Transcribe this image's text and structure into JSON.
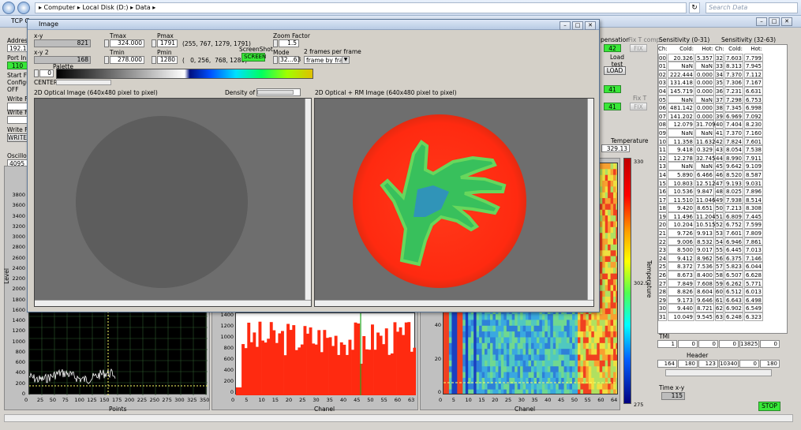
{
  "explorer": {
    "path": "▸ Computer ▸ Local Disk (D:) ▸ Data ▸",
    "search_placeholder": "Search Data"
  },
  "bgapp": {
    "title": "TCP G",
    "address_label": "Address",
    "address_value": "192.16",
    "port_label": "Port Inp",
    "port_value": "110",
    "start_label": "Start Fr",
    "config_label": "Configu",
    "off_label": "OFF",
    "write1_label": "Write Fi",
    "write2_label": "Write Fi",
    "write3_label": "Write Fi",
    "write_btn": "WRITE",
    "osc_label": "Oscillosc",
    "osc_top": "4095",
    "compensation_label": "pensation",
    "comp_val": "42",
    "load_test_label": "Load test T",
    "load_btn": "LOAD",
    "val41a": "41",
    "val41b": "41",
    "fix_t_comp_label": "Fix T comp",
    "fix_btn1": "FIX",
    "fix_t_label": "Fix T",
    "fix_btn2": "FIX",
    "temp_label": "Temperature",
    "temp_value": "329.13",
    "temp_axis_label": "Temperature",
    "colorbar_ticks": [
      "330",
      "302.5",
      "275"
    ],
    "sens_label1": "Sensitivity (0-31)",
    "sens_label2": "Sensitivity (32-63)",
    "sens_head": [
      "Ch:",
      "Cold:",
      "Hot:",
      "Ch:",
      "Cold:",
      "Hot:"
    ],
    "sens_rows": [
      [
        "00",
        "20.326",
        "5.357",
        "32",
        "7.603",
        "7.799"
      ],
      [
        "01",
        "NaN",
        "NaN",
        "33",
        "8.313",
        "7.945"
      ],
      [
        "02",
        "222.444",
        "0.000",
        "34",
        "7.370",
        "7.112"
      ],
      [
        "03",
        "131.418",
        "0.000",
        "35",
        "7.306",
        "7.167"
      ],
      [
        "04",
        "145.719",
        "0.000",
        "36",
        "7.231",
        "6.631"
      ],
      [
        "05",
        "NaN",
        "NaN",
        "37",
        "7.298",
        "6.753"
      ],
      [
        "06",
        "481.142",
        "0.000",
        "38",
        "7.345",
        "6.998"
      ],
      [
        "07",
        "141.202",
        "0.000",
        "39",
        "6.969",
        "7.092"
      ],
      [
        "08",
        "12.079",
        "31.709",
        "40",
        "7.404",
        "8.230"
      ],
      [
        "09",
        "NaN",
        "NaN",
        "41",
        "7.370",
        "7.160"
      ],
      [
        "10",
        "11.358",
        "11.632",
        "42",
        "7.824",
        "7.601"
      ],
      [
        "11",
        "9.418",
        "0.329",
        "43",
        "8.054",
        "7.538"
      ],
      [
        "12",
        "12.278",
        "32.745",
        "44",
        "8.990",
        "7.911"
      ],
      [
        "13",
        "NaN",
        "NaN",
        "45",
        "9.642",
        "9.109"
      ],
      [
        "14",
        "5.890",
        "6.466",
        "46",
        "8.520",
        "8.587"
      ],
      [
        "15",
        "10.803",
        "12.512",
        "47",
        "9.193",
        "9.031"
      ],
      [
        "16",
        "10.536",
        "9.847",
        "48",
        "8.025",
        "7.896"
      ],
      [
        "17",
        "11.510",
        "11.046",
        "49",
        "7.938",
        "8.514"
      ],
      [
        "18",
        "9.420",
        "8.651",
        "50",
        "7.213",
        "8.308"
      ],
      [
        "19",
        "11.496",
        "11.204",
        "51",
        "6.809",
        "7.445"
      ],
      [
        "20",
        "10.204",
        "10.515",
        "52",
        "6.752",
        "7.599"
      ],
      [
        "21",
        "9.726",
        "9.913",
        "53",
        "7.601",
        "7.809"
      ],
      [
        "22",
        "9.006",
        "8.532",
        "54",
        "6.946",
        "7.861"
      ],
      [
        "23",
        "8.500",
        "9.017",
        "55",
        "6.445",
        "7.013"
      ],
      [
        "24",
        "9.412",
        "8.962",
        "56",
        "6.375",
        "7.146"
      ],
      [
        "25",
        "8.372",
        "7.536",
        "57",
        "5.823",
        "6.044"
      ],
      [
        "26",
        "8.673",
        "8.400",
        "58",
        "6.507",
        "6.628"
      ],
      [
        "27",
        "7.849",
        "7.608",
        "59",
        "6.262",
        "5.771"
      ],
      [
        "28",
        "8.826",
        "8.604",
        "60",
        "6.512",
        "6.013"
      ],
      [
        "29",
        "9.173",
        "9.646",
        "61",
        "6.643",
        "6.498"
      ],
      [
        "30",
        "9.440",
        "8.721",
        "62",
        "6.902",
        "6.549"
      ],
      [
        "31",
        "10.049",
        "9.545",
        "63",
        "6.248",
        "6.323"
      ]
    ],
    "tmi_label": "TMI",
    "tmi_values": [
      "1",
      "0",
      "0",
      "0",
      "13825",
      "0"
    ],
    "header_label": "Header",
    "header_values": [
      "164",
      "180",
      "123",
      "10340",
      "0",
      "180"
    ],
    "time_xy_label": "Time x-y",
    "time_xy_value": "115",
    "stop_btn": "STOP",
    "level_label": "Level",
    "points_label": "Points",
    "chanel_label1": "Chanel",
    "chanel_label2": "Chanel"
  },
  "image_window": {
    "title": "Image",
    "xy_label": "x-y",
    "xy_value": "821",
    "xy2_label": "x-y 2",
    "xy2_value": "168",
    "tmax_label": "Tmax",
    "tmax_value": "324.000",
    "tmin_label": "Tmin",
    "tmin_value": "278.000",
    "pmax_label": "Pmax",
    "pmax_value": "1791",
    "pmin_label": "Pmin",
    "pmin_value": "1280",
    "coords1": "(255, 767, 1279, 1791)",
    "coords2": "(   0, 256,  768, 1280)",
    "screenshot_label": "ScreenShot",
    "screenshot_btn": "SCREEN",
    "zoom_label": "Zoom Factor",
    "zoom_value": "1.5",
    "mode_label": "Mode",
    "mode_value": "32...63",
    "frames_label": "2 frames per frame",
    "frames_value": "frame by frame",
    "palette_label": "Palette",
    "palette_value": "0",
    "center_label": "CENTER",
    "optical_label": "2D Optical Image (640x480 pixel to pixel)",
    "density_label": "Density of marker",
    "rm_label": "2D Optical + RM  Image (640x480 pixel to pixel)"
  },
  "charts": {
    "osc_y_ticks": [
      "3800",
      "3600",
      "3400",
      "3200",
      "3000",
      "2800",
      "2600",
      "2400",
      "2200",
      "2000",
      "1800",
      "1600",
      "1400",
      "1200",
      "1000",
      "800",
      "600",
      "400",
      "200",
      "0"
    ],
    "osc_x_ticks": [
      "0",
      "25",
      "50",
      "75",
      "100",
      "125",
      "150",
      "175",
      "200",
      "225",
      "250",
      "275",
      "300",
      "325",
      "350"
    ],
    "bar_y_ticks": [
      "1400",
      "1200",
      "1000",
      "800",
      "600",
      "400",
      "200",
      "0"
    ],
    "bar_x_ticks": [
      "0",
      "5",
      "10",
      "15",
      "20",
      "25",
      "30",
      "35",
      "40",
      "45",
      "50",
      "55",
      "60",
      "63"
    ],
    "heat_y_ticks": [
      "120",
      "100",
      "80",
      "60",
      "40",
      "20",
      "0"
    ],
    "heat_x_ticks": [
      "0",
      "5",
      "10",
      "15",
      "20",
      "25",
      "30",
      "35",
      "40",
      "45",
      "50",
      "55",
      "60",
      "64"
    ]
  }
}
